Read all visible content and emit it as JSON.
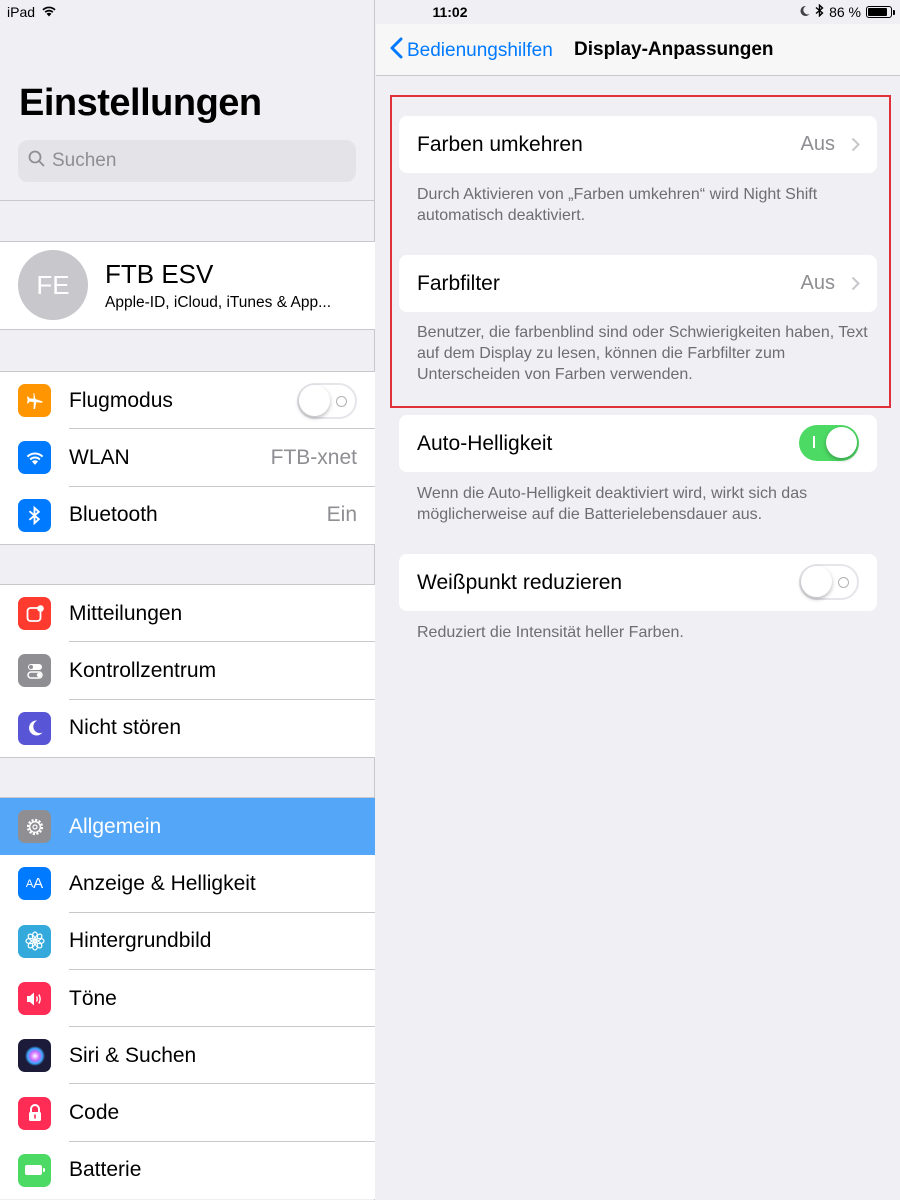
{
  "status_bar": {
    "device": "iPad",
    "time": "11:02",
    "battery": "86 %",
    "battery_level": 0.86
  },
  "sidebar": {
    "title": "Einstellungen",
    "search_placeholder": "Suchen",
    "profile": {
      "initials": "FE",
      "name": "FTB ESV",
      "subtitle": "Apple-ID, iCloud, iTunes & App..."
    },
    "group1": [
      {
        "label": "Flugmodus",
        "icon": "airplane-icon",
        "color": "#ff9500",
        "toggle": false
      },
      {
        "label": "WLAN",
        "icon": "wifi-icon",
        "color": "#007aff",
        "value": "FTB-xnet"
      },
      {
        "label": "Bluetooth",
        "icon": "bluetooth-icon",
        "color": "#007aff",
        "value": "Ein"
      }
    ],
    "group2": [
      {
        "label": "Mitteilungen",
        "icon": "notifications-icon",
        "color": "#ff3b30"
      },
      {
        "label": "Kontrollzentrum",
        "icon": "control-center-icon",
        "color": "#8e8e93"
      },
      {
        "label": "Nicht stören",
        "icon": "moon-icon",
        "color": "#5856d6"
      }
    ],
    "group3": [
      {
        "label": "Allgemein",
        "icon": "gear-icon",
        "color": "#8e8e93",
        "selected": true
      },
      {
        "label": "Anzeige & Helligkeit",
        "icon": "text-size-icon",
        "color": "#007aff"
      },
      {
        "label": "Hintergrundbild",
        "icon": "flower-icon",
        "color": "#34aadc"
      },
      {
        "label": "Töne",
        "icon": "speaker-icon",
        "color": "#ff2d55"
      },
      {
        "label": "Siri & Suchen",
        "icon": "siri-icon",
        "color": "#1c1c3a"
      },
      {
        "label": "Code",
        "icon": "lock-icon",
        "color": "#ff2d55"
      },
      {
        "label": "Batterie",
        "icon": "battery-icon",
        "color": "#4cd964"
      }
    ]
  },
  "detail": {
    "back_label": "Bedienungshilfen",
    "title": "Display-Anpassungen",
    "invert": {
      "label": "Farben umkehren",
      "value": "Aus",
      "footer": "Durch Aktivieren von „Farben umkehren“ wird Night Shift automatisch deaktiviert."
    },
    "filter": {
      "label": "Farbfilter",
      "value": "Aus",
      "footer": "Benutzer, die farbenblind sind oder Schwierigkeiten haben, Text auf dem Display zu lesen, können die Farbfilter zum Unterscheiden von Farben verwenden."
    },
    "auto_brightness": {
      "label": "Auto-Helligkeit",
      "on": true,
      "footer": "Wenn die Auto-Helligkeit deaktiviert wird, wirkt sich das möglicherweise auf die Batterielebensdauer aus."
    },
    "white_point": {
      "label": "Weißpunkt reduzieren",
      "on": false,
      "footer": "Reduziert die Intensität heller Farben."
    }
  },
  "colors": {
    "accent": "#007aff",
    "selected_row": "#53a6f8",
    "toggle_on": "#4cd964",
    "highlight_box": "#e0313a"
  }
}
